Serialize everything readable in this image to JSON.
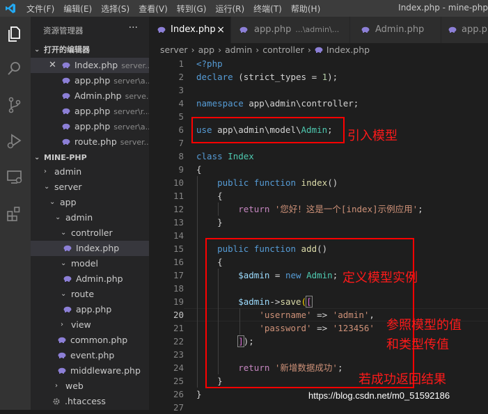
{
  "titlebar": {
    "menus": [
      "文件(F)",
      "编辑(E)",
      "选择(S)",
      "查看(V)",
      "转到(G)",
      "运行(R)",
      "终端(T)",
      "帮助(H)"
    ],
    "window_title": "Index.php - mine-php"
  },
  "sidebar": {
    "header": "资源管理器",
    "more": "···",
    "open_editors_label": "打开的编辑器",
    "open_editors": [
      {
        "name": "Index.php",
        "path": "server..."
      },
      {
        "name": "app.php",
        "path": "server\\a..."
      },
      {
        "name": "Admin.php",
        "path": "serve..."
      },
      {
        "name": "app.php",
        "path": "server\\r..."
      },
      {
        "name": "app.php",
        "path": "server\\a..."
      },
      {
        "name": "route.php",
        "path": "server..."
      }
    ],
    "project_label": "MINE-PHP",
    "tree": [
      {
        "label": "admin"
      },
      {
        "label": "server"
      },
      {
        "label": "app"
      },
      {
        "label": "admin"
      },
      {
        "label": "controller"
      },
      {
        "label": "Index.php"
      },
      {
        "label": "model"
      },
      {
        "label": "Admin.php"
      },
      {
        "label": "route"
      },
      {
        "label": "app.php"
      },
      {
        "label": "view"
      },
      {
        "label": "common.php"
      },
      {
        "label": "event.php"
      },
      {
        "label": "middleware.php"
      },
      {
        "label": "web"
      },
      {
        "label": ".htaccess"
      }
    ]
  },
  "tabs": [
    {
      "label": "Index.php",
      "path": ""
    },
    {
      "label": "app.php",
      "path": "...\\admin\\..."
    },
    {
      "label": "Admin.php",
      "path": ""
    },
    {
      "label": "app.php",
      "path": ""
    }
  ],
  "tab_close": "×",
  "breadcrumb": [
    "server",
    "app",
    "admin",
    "controller",
    "Index.php"
  ],
  "line_numbers": [
    "1",
    "2",
    "3",
    "4",
    "5",
    "6",
    "7",
    "8",
    "9",
    "10",
    "11",
    "12",
    "13",
    "14",
    "15",
    "16",
    "17",
    "18",
    "19",
    "20",
    "21",
    "22",
    "23",
    "24",
    "25",
    "26",
    "27"
  ],
  "code": {
    "l1": "<?php",
    "l2_kw": "declare",
    "l2_rest": " (strict_types = ",
    "l2_num": "1",
    "l2_end": ");",
    "l4_kw": "namespace",
    "l4_ns": " app\\admin\\controller;",
    "l6_kw": "use",
    "l6_ns": " app\\admin\\model\\",
    "l6_cls": "Admin",
    "l6_end": ";",
    "l8_kw": "class",
    "l8_cls": "Index",
    "l9": "{",
    "l10_kw1": "public",
    "l10_kw2": "function",
    "l10_fn": "index",
    "l10_end": "()",
    "l11": "{",
    "l12_kw": "return",
    "l12_str": "'您好！这是一个[index]示例应用'",
    "l12_end": ";",
    "l13": "}",
    "l15_kw1": "public",
    "l15_kw2": "function",
    "l15_fn": "add",
    "l15_end": "()",
    "l16": "{",
    "l17_var": "$admin",
    "l17_eq": " = ",
    "l17_new": "new",
    "l17_cls": "Admin",
    "l17_end": ";",
    "l19_var": "$admin",
    "l19_arrow": "->",
    "l19_fn": "save",
    "l19_p": "(",
    "l19_b": "[",
    "l20_key": "'username'",
    "l20_op": " => ",
    "l20_val": "'admin'",
    "l20_end": ",",
    "l21_key": "'password'",
    "l21_op": " => ",
    "l21_val": "'123456'",
    "l22_b": "]",
    "l22_end": ");",
    "l24_kw": "return",
    "l24_str": "'新增数据成功'",
    "l24_end": ";",
    "l25": "}",
    "l26": "}"
  },
  "annotations": {
    "import": "引入模型",
    "instance": "定义模型实例",
    "params_1": "参照模型的值",
    "params_2": "和类型传值",
    "result": "若成功返回结果"
  },
  "watermark": "https://blog.csdn.net/m0_51592186",
  "colors": {
    "annotation_red": "#ff0000",
    "keyword_blue": "#569cd6",
    "string_orange": "#ce9178",
    "class_teal": "#4ec9b0",
    "php_purple": "#8c7fd6"
  }
}
